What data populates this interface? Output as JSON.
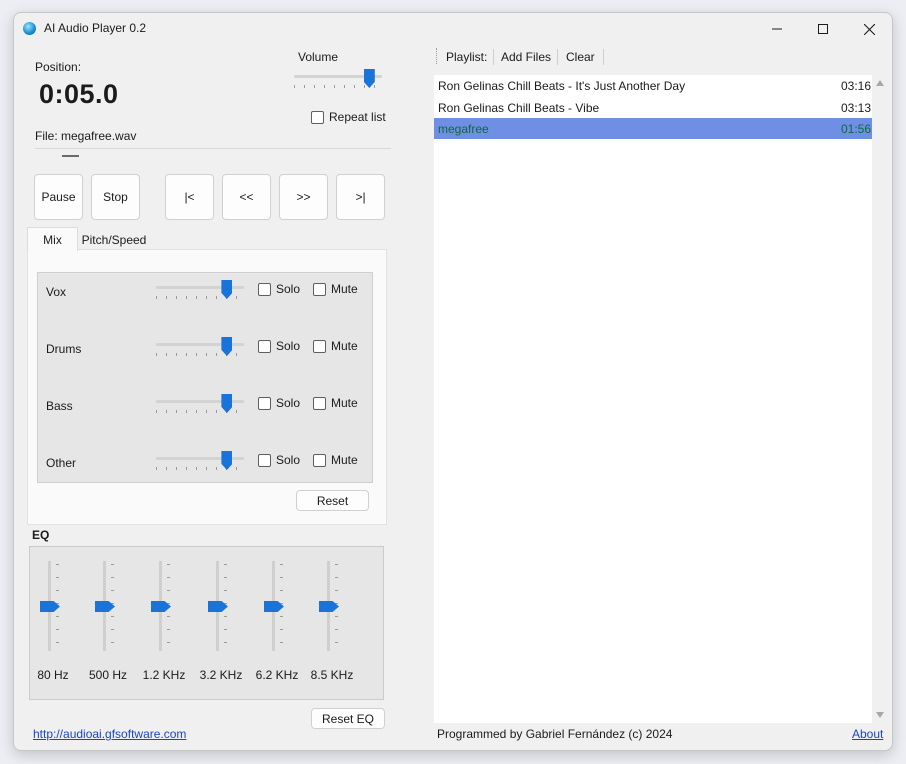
{
  "window": {
    "title": "AI Audio Player 0.2"
  },
  "player": {
    "position_label": "Position:",
    "position_value": "0:05.0",
    "file_label": "File: megafree.wav",
    "volume_label": "Volume",
    "volume_level": 0.85,
    "repeat_label": "Repeat list",
    "repeat_checked": false
  },
  "transport": {
    "pause": "Pause",
    "stop": "Stop",
    "first": "|<",
    "rewind": "<<",
    "forward": ">>",
    "last": ">|"
  },
  "tabs": [
    {
      "label": "Mix",
      "active": true
    },
    {
      "label": "Pitch/Speed",
      "active": false
    }
  ],
  "mix": {
    "solo_label": "Solo",
    "mute_label": "Mute",
    "reset_label": "Reset",
    "channels": [
      {
        "name": "Vox",
        "level": 0.8
      },
      {
        "name": "Drums",
        "level": 0.8
      },
      {
        "name": "Bass",
        "level": 0.8
      },
      {
        "name": "Other",
        "level": 0.8
      }
    ]
  },
  "eq": {
    "title": "EQ",
    "reset_label": "Reset EQ",
    "bands": [
      {
        "label": "80 Hz",
        "level": 0.5
      },
      {
        "label": "500 Hz",
        "level": 0.5
      },
      {
        "label": "1.2 KHz",
        "level": 0.5
      },
      {
        "label": "3.2 KHz",
        "level": 0.5
      },
      {
        "label": "6.2 KHz",
        "level": 0.5
      },
      {
        "label": "8.5 KHz",
        "level": 0.5
      }
    ]
  },
  "playlist": {
    "toolbar": {
      "label": "Playlist:",
      "add": "Add Files",
      "clear": "Clear"
    },
    "items": [
      {
        "title": "Ron Gelinas Chill Beats - It's Just Another Day",
        "duration": "03:16",
        "selected": false
      },
      {
        "title": "Ron Gelinas Chill Beats - Vibe",
        "duration": "03:13",
        "selected": false
      },
      {
        "title": "megafree",
        "duration": "01:56",
        "selected": true
      }
    ]
  },
  "footer": {
    "link": "http://audioai.gfsoftware.com",
    "credits": "Programmed by Gabriel Fernández (c) 2024",
    "about": "About"
  },
  "colors": {
    "accent": "#1a73d9",
    "selection": "#6e8fe4",
    "selection_text": "#0d6b3c"
  }
}
